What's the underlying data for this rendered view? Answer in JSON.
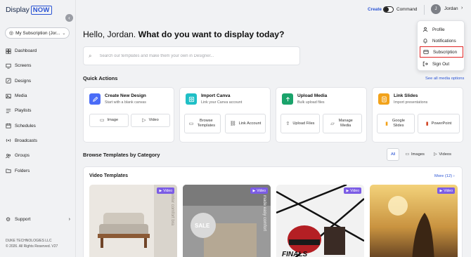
{
  "brand": {
    "logo_part1": "Display",
    "logo_part2": "NOW"
  },
  "sidebar": {
    "subscription_label": "My Subscription (Jor...",
    "items": [
      {
        "label": "Dashboard",
        "icon": "dashboard-icon"
      },
      {
        "label": "Screens",
        "icon": "screen-icon"
      },
      {
        "label": "Designs",
        "icon": "design-icon"
      },
      {
        "label": "Media",
        "icon": "media-icon"
      },
      {
        "label": "Playlists",
        "icon": "playlist-icon"
      },
      {
        "label": "Schedules",
        "icon": "calendar-icon"
      },
      {
        "label": "Broadcasts",
        "icon": "broadcast-icon"
      },
      {
        "label": "Groups",
        "icon": "groups-icon"
      },
      {
        "label": "Folders",
        "icon": "folder-icon"
      }
    ],
    "support_label": "Support",
    "copyright_line1": "DUKE TECHNOLOGIES LLC",
    "copyright_line2": "© 2026. All Rights Reserved. V27"
  },
  "topbar": {
    "create_label": "Create",
    "command_label": "Command",
    "avatar_initial": "J",
    "user_name": "Jordan"
  },
  "greeting": {
    "hello": "Hello, Jordan.",
    "question": "What do you want to display today?"
  },
  "search": {
    "placeholder": "Search our templates and make them your own in Designer..."
  },
  "quick_actions": {
    "title": "Quick Actions",
    "see_all": "See all media options",
    "cards": [
      {
        "title": "Create New Design",
        "subtitle": "Start with a blank canvas",
        "icon_color": "#4a6cf7",
        "buttons": [
          "Image",
          "Video"
        ]
      },
      {
        "title": "Import Canva",
        "subtitle": "Link your Canva account",
        "icon_color": "#1fbfc6",
        "buttons": [
          "Browse Templates",
          "Link Account"
        ]
      },
      {
        "title": "Upload Media",
        "subtitle": "Bulk upload files",
        "icon_color": "#1aa36b",
        "buttons": [
          "Upload Files",
          "Manage Media"
        ]
      },
      {
        "title": "Link Slides",
        "subtitle": "Import presentations",
        "icon_color": "#f2a21a",
        "buttons": [
          "Google Slides",
          "PowerPoint"
        ]
      }
    ]
  },
  "templates": {
    "section_title": "Browse Templates by Category",
    "filters": [
      "All",
      "Images",
      "Videos"
    ],
    "panel_title": "Video Templates",
    "more_label": "More (12)",
    "badge_label": "Video",
    "thumb_text": [
      "winter comfort bra",
      "SALE",
      "made easy comfort",
      "FINALS"
    ]
  },
  "dropdown": {
    "items": [
      "Profile",
      "Notifications",
      "Subscription",
      "Sign Out"
    ],
    "highlighted": "Subscription"
  },
  "colors": {
    "accent": "#2b54d4",
    "highlight_border": "#e02424",
    "badge": "#7b5ce5"
  }
}
